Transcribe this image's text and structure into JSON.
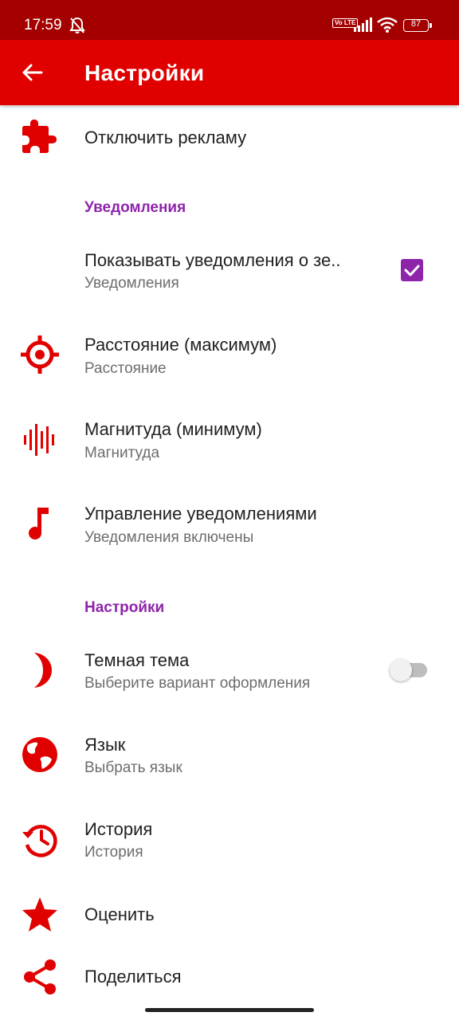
{
  "status_bar": {
    "time": "17:59",
    "volte": "Vo LTE",
    "battery": "87",
    "icons": [
      "bell-off-icon",
      "volte-icon",
      "signal-icon",
      "wifi-icon",
      "battery-icon"
    ]
  },
  "app_bar": {
    "title": "Настройки",
    "back_icon": "arrow-back-icon"
  },
  "colors": {
    "status_bar": "#a50000",
    "app_bar": "#e00000",
    "accent_icon": "#e00000",
    "section_header": "#8e24aa",
    "checkbox": "#8e24aa"
  },
  "items": {
    "disable_ads": {
      "title": "Отключить рекламу",
      "icon": "puzzle-icon"
    },
    "notifications_header": "Уведомления",
    "show_notifications": {
      "title": "Показывать уведомления о зе..",
      "subtitle": "Уведомления",
      "checked": true
    },
    "distance": {
      "title": "Расстояние (максимум)",
      "subtitle": "Расстояние",
      "icon": "target-icon"
    },
    "magnitude": {
      "title": "Магнитуда (минимум)",
      "subtitle": "Магнитуда",
      "icon": "waveform-icon"
    },
    "manage_notifications": {
      "title": "Управление уведомлениями",
      "subtitle": "Уведомления включены",
      "icon": "music-note-icon"
    },
    "settings_header": "Настройки",
    "dark_theme": {
      "title": "Темная тема",
      "subtitle": "Выберите вариант оформления",
      "icon": "moon-icon",
      "enabled": false
    },
    "language": {
      "title": "Язык",
      "subtitle": "Выбрать язык",
      "icon": "globe-icon"
    },
    "history": {
      "title": "История",
      "subtitle": "История",
      "icon": "history-icon"
    },
    "rate": {
      "title": "Оценить",
      "icon": "star-icon"
    },
    "share": {
      "title": "Поделиться",
      "icon": "share-icon"
    }
  }
}
